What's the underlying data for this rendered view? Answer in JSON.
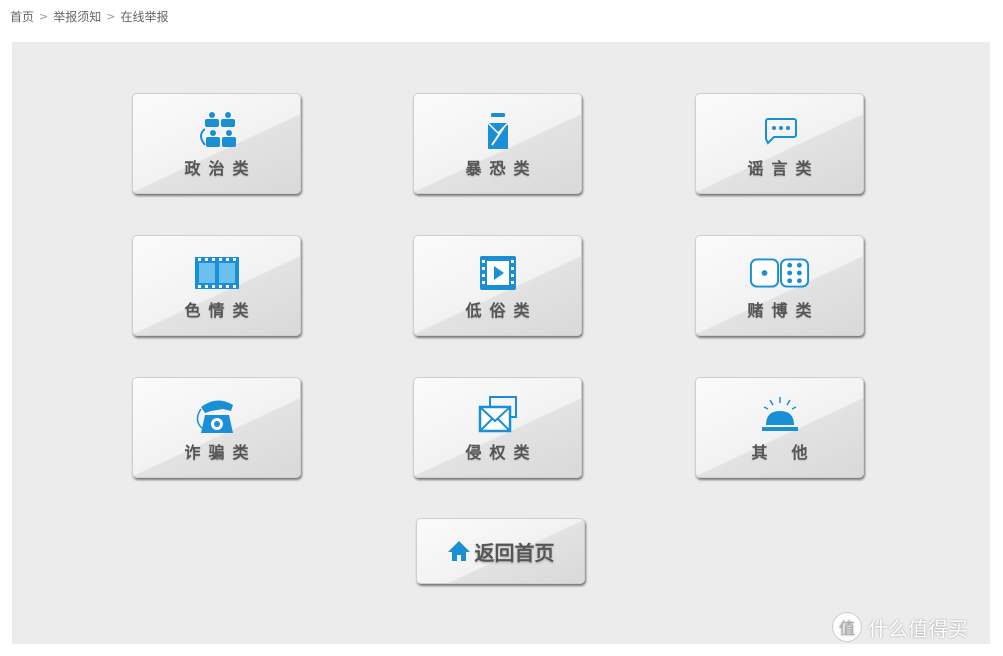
{
  "breadcrumb": [
    "首页",
    "举报须知",
    "在线举报"
  ],
  "categories": [
    {
      "label": "政治类",
      "icon": "people-meeting-icon"
    },
    {
      "label": "暴恐类",
      "icon": "terror-person-icon"
    },
    {
      "label": "谣言类",
      "icon": "chat-bubbles-icon"
    },
    {
      "label": "色情类",
      "icon": "film-strip-icon"
    },
    {
      "label": "低俗类",
      "icon": "video-play-icon"
    },
    {
      "label": "赌博类",
      "icon": "dice-icon"
    },
    {
      "label": "诈骗类",
      "icon": "telephone-icon"
    },
    {
      "label": "侵权类",
      "icon": "envelopes-icon"
    },
    {
      "label": "其他",
      "icon": "service-bell-icon"
    }
  ],
  "home_button": "返回首页",
  "watermark": {
    "badge": "值",
    "text": "什么值得买"
  },
  "colors": {
    "accent": "#1a8fd6",
    "panel": "#ececec"
  }
}
